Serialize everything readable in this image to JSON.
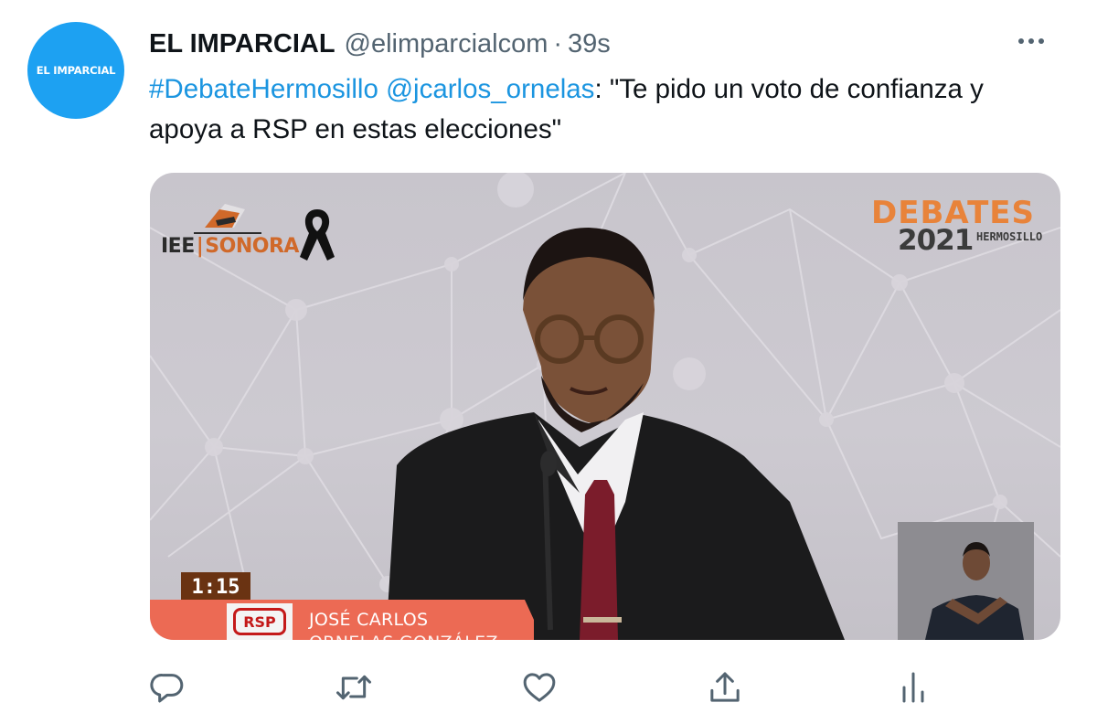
{
  "tweet": {
    "author": {
      "avatar_text": "EL IMPARCIAL",
      "name": "EL IMPARCIAL",
      "handle": "@elimparcialcom",
      "separator": "·",
      "time": "39s"
    },
    "text": {
      "hashtag": "#DebateHermosillo",
      "mention": "@jcarlos_ornelas",
      "body": ": \"Te pido un voto de confianza y apoya a RSP en estas elecciones\""
    },
    "media": {
      "organizer_logo": {
        "part1": "IEE",
        "separator": "|",
        "part2": "SONORA"
      },
      "event_logo": {
        "title": "DEBATES",
        "year": "2021",
        "city": "HERMOSILLO"
      },
      "timer": "1:15",
      "party_logo_text": "RSP",
      "candidate_name_line1": "JOSÉ CARLOS",
      "candidate_name_line2": "ORNELAS GONZÁLEZ"
    }
  },
  "actions": {
    "icons": [
      "reply-icon",
      "retweet-icon",
      "like-icon",
      "share-icon",
      "analytics-icon"
    ],
    "color": "#536471"
  },
  "colors": {
    "link": "#1b95e0",
    "avatar_bg": "#1da1f2",
    "secondary_text": "#536471"
  }
}
